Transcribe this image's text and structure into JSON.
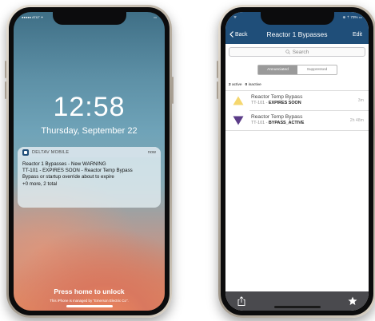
{
  "lock_screen": {
    "status_carrier": "●●●●● AT&T ✦",
    "status_battery": "▭",
    "time": "12:58",
    "date": "Thursday, September 22",
    "notification": {
      "app_name": "DELTAV MOBILE",
      "timestamp": "now",
      "lines": [
        "Reactor 1 Bypasses - New WARNING",
        "TT-101 - EXPIRES SOON - Reactor Temp Bypass",
        "Bypass or startup override about to expire",
        "+0 more, 2 total"
      ]
    },
    "unlock_prompt": "Press home to unlock",
    "managed_notice": "This iPhone is managed by \"Emerson Electric Co\"."
  },
  "app_screen": {
    "status_left": "ᯤ",
    "status_right": "⊕ ⇡ 73% ▭",
    "nav": {
      "back_label": "Back",
      "title": "Reactor 1 Bypasses",
      "edit_label": "Edit"
    },
    "search_placeholder": "Search",
    "segments": [
      "Annunciated",
      "Suppressed"
    ],
    "counts": {
      "active_count": "2",
      "active_label": "active",
      "inactive_count": "0",
      "inactive_label": "inactive"
    },
    "items": [
      {
        "title": "Reactor Temp Bypass",
        "tag": "TT-101 - ",
        "status": "EXPIRES SOON",
        "time": "3m",
        "icon": "warning-triangle-icon",
        "icon_color": "#f5d76e"
      },
      {
        "title": "Reactor Temp Bypass",
        "tag": "TT-101 - ",
        "status": "BYPASS_ACTIVE",
        "time": "2h 48m",
        "icon": "bypass-triangle-icon",
        "icon_color": "#5b3c88"
      }
    ],
    "toolbar": {
      "share_icon": "share-icon",
      "favorite_icon": "star-icon"
    }
  },
  "colors": {
    "nav_bar": "#1f4e79",
    "toolbar": "#4a4a4e",
    "warning": "#f5d76e",
    "bypass": "#5b3c88"
  }
}
